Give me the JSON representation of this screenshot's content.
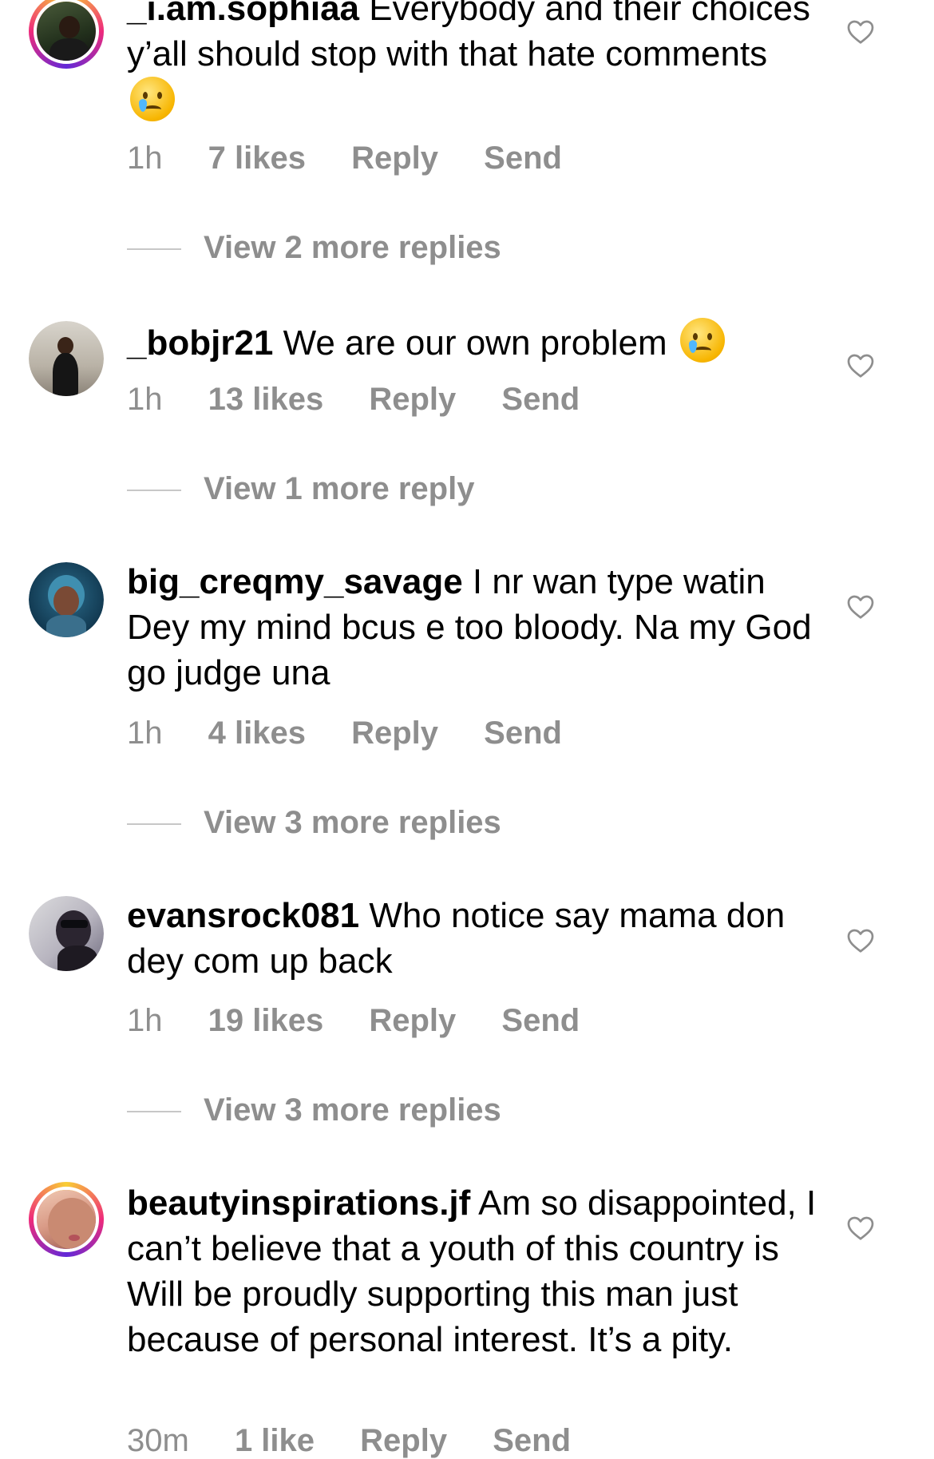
{
  "comments": [
    {
      "username": "_i.am.sophiaa",
      "text": "Everybody and their choices y’all should stop with that hate comments",
      "emoji": "crying-face",
      "time": "1h",
      "likes": "7 likes",
      "reply": "Reply",
      "send": "Send",
      "view_replies": "View 2 more replies"
    },
    {
      "username": "_bobjr21",
      "text": "We are our own problem",
      "emoji": "crying-face",
      "time": "1h",
      "likes": "13 likes",
      "reply": "Reply",
      "send": "Send",
      "view_replies": "View 1 more reply"
    },
    {
      "username": "big_creqmy_savage",
      "text": "I nr wan type watin Dey my mind bcus e too bloody. Na my God go judge una",
      "time": "1h",
      "likes": "4 likes",
      "reply": "Reply",
      "send": "Send",
      "view_replies": "View 3 more replies"
    },
    {
      "username": "evansrock081",
      "text": "Who notice say mama don dey com up back",
      "time": "1h",
      "likes": "19 likes",
      "reply": "Reply",
      "send": "Send",
      "view_replies": "View 3 more replies"
    },
    {
      "username": "beautyinspirations.jf",
      "text": "Am so disappointed, I can’t believe that a youth of this country is Will be proudly supporting this man just because of personal interest. It’s a pity.",
      "time": "30m",
      "likes": "1 like",
      "reply": "Reply",
      "send": "Send"
    }
  ],
  "colors": {
    "secondary_text": "#8e8e8e",
    "story_ring": "#ee2a7b"
  },
  "icons": {
    "like": "heart-outline-icon"
  }
}
